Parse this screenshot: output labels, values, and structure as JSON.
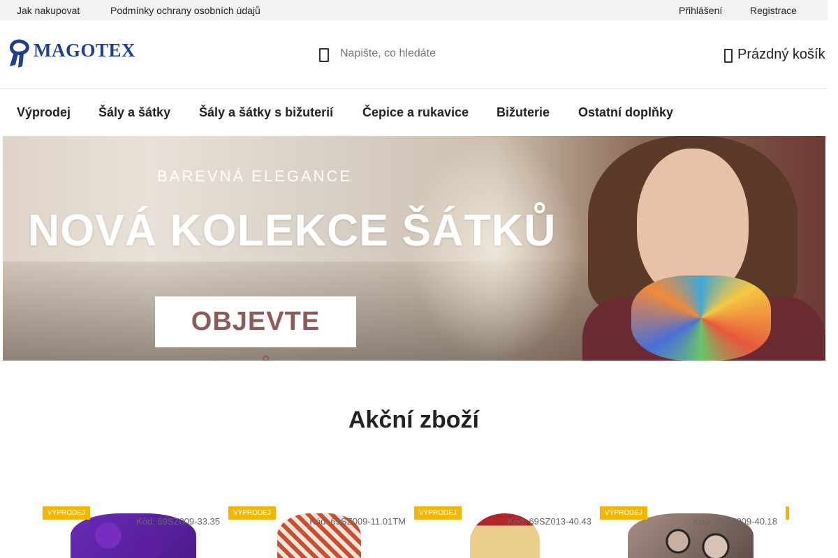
{
  "topbar": {
    "left_links": [
      "Jak nakupovat",
      "Podmínky ochrany osobních údajů"
    ],
    "right_links": [
      "Přihlášení",
      "Registrace"
    ]
  },
  "header": {
    "logo_text": "MAGOTEX",
    "search_placeholder": "Napište, co hledáte",
    "cart_label": "Prázdný košík"
  },
  "nav": {
    "items": [
      "Výprodej",
      "Šály a šátky",
      "Šály a šátky s bižuterií",
      "Čepice a rukavice",
      "Bižuterie",
      "Ostatní doplňky"
    ]
  },
  "banner": {
    "subtitle": "BAREVNÁ ELEGANCE",
    "title": "NOVÁ KOLEKCE ŠÁTKŮ",
    "button": "OBJEVTE SVŮJ"
  },
  "section": {
    "title": "Akční zboží"
  },
  "products": [
    {
      "badge": "VÝPRODEJ",
      "code": "Kód: 69SZ009-33.35",
      "image": "purple-scarf"
    },
    {
      "badge": "VÝPRODEJ",
      "code": "Kód: 69SZ009-11.01TM",
      "image": "red-houndstooth-scarf"
    },
    {
      "badge": "VÝPRODEJ",
      "code": "Kód: 69SZ013-40.43",
      "image": "yellow-knit-scarf"
    },
    {
      "badge": "VÝPRODEJ",
      "code": "Kód: 69SZ009-40.18",
      "image": "grey-circle-scarf"
    }
  ],
  "colors": {
    "badge": "#f2b705",
    "logo": "#1f3f8f",
    "topbar_bg": "#f2f2f2"
  }
}
